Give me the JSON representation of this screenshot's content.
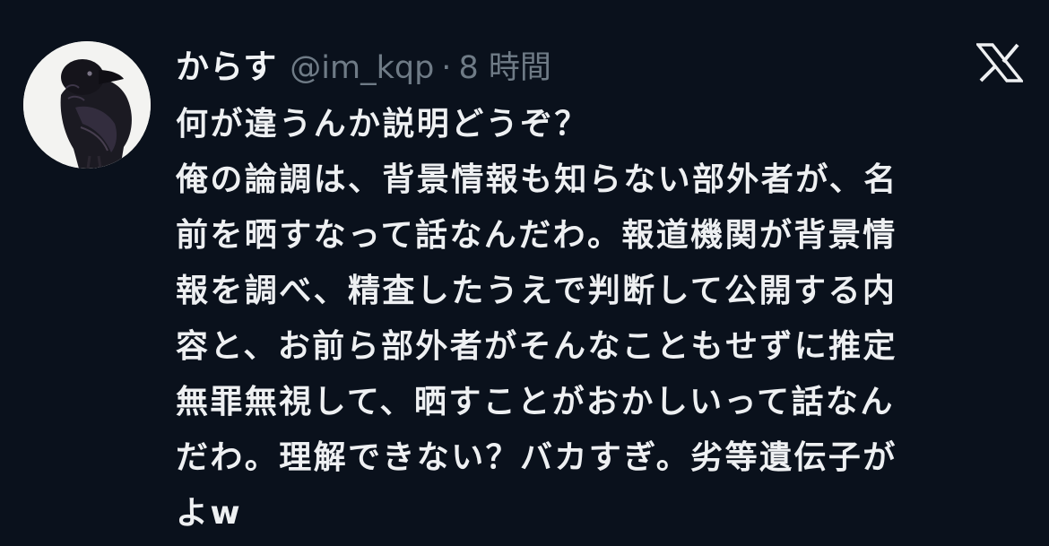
{
  "tweet": {
    "display_name": "からす",
    "handle": "@im_kqp",
    "separator": "·",
    "time": "8 時間",
    "lines": [
      "何が違うんか説明どうぞ？",
      "俺の論調は、背景情報も知らない部外者が、名",
      "前を晒すなって話なんだわ。報道機関が背景情",
      "報を調べ、精査したうえで判断して公開する内",
      "容と、お前ら部外者がそんなこともせずに推定",
      "無罪無視して、晒すことがおかしいって話なん",
      "だわ。理解できない？バカすぎ。劣等遺伝子が",
      "よw"
    ]
  },
  "icons": {
    "avatar": "crow-avatar",
    "platform": "x-logo-icon"
  },
  "colors": {
    "background": "#0a111c",
    "text": "#eef0f2",
    "muted": "#6f7b86"
  }
}
